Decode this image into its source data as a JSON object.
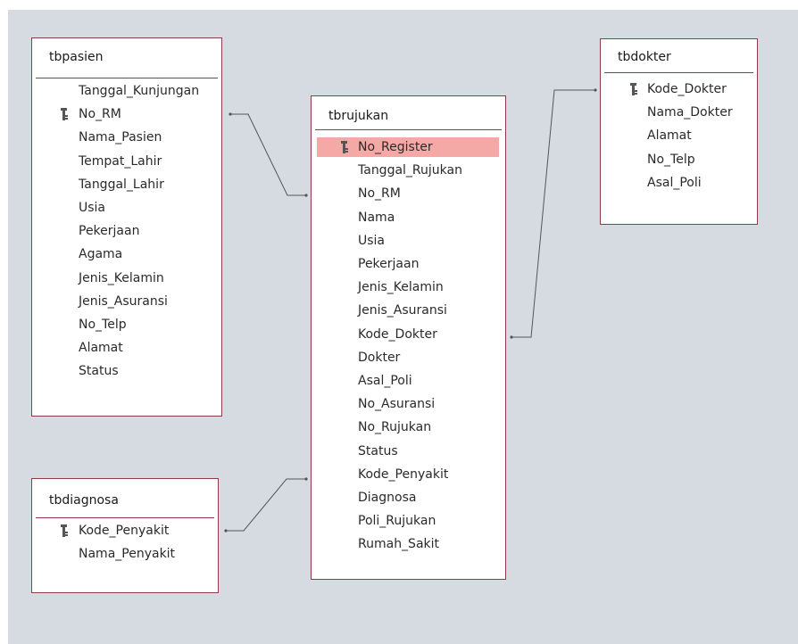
{
  "accent_color": "#8f3b47",
  "highlight_color": "#f4a9a6",
  "tables": {
    "tbpasien": {
      "name": "tbpasien",
      "fields": [
        "Tanggal_Kunjungan",
        "No_RM",
        "Nama_Pasien",
        "Tempat_Lahir",
        "Tanggal_Lahir",
        "Usia",
        "Pekerjaan",
        "Agama",
        "Jenis_Kelamin",
        "Jenis_Asuransi",
        "No_Telp",
        "Alamat",
        "Status"
      ],
      "key_field": "No_RM"
    },
    "tbrujukan": {
      "name": "tbrujukan",
      "fields": [
        "No_Register",
        "Tanggal_Rujukan",
        "No_RM",
        "Nama",
        "Usia",
        "Pekerjaan",
        "Jenis_Kelamin",
        "Jenis_Asuransi",
        "Kode_Dokter",
        "Dokter",
        "Asal_Poli",
        "No_Asuransi",
        "No_Rujukan",
        "Status",
        "Kode_Penyakit",
        "Diagnosa",
        "Poli_Rujukan",
        "Rumah_Sakit"
      ],
      "key_field": "No_Register",
      "selected_field": "No_Register"
    },
    "tbdokter": {
      "name": "tbdokter",
      "fields": [
        "Kode_Dokter",
        "Nama_Dokter",
        "Alamat",
        "No_Telp",
        "Asal_Poli"
      ],
      "key_field": "Kode_Dokter"
    },
    "tbdiagnosa": {
      "name": "tbdiagnosa",
      "fields": [
        "Kode_Penyakit",
        "Nama_Penyakit"
      ],
      "key_field": "Kode_Penyakit"
    }
  },
  "relationships": [
    {
      "from": "tbpasien.No_RM",
      "to": "tbrujukan.No_RM"
    },
    {
      "from": "tbdiagnosa.Kode_Penyakit",
      "to": "tbrujukan.Kode_Penyakit"
    },
    {
      "from": "tbrujukan.Kode_Dokter",
      "to": "tbdokter.Kode_Dokter"
    }
  ]
}
